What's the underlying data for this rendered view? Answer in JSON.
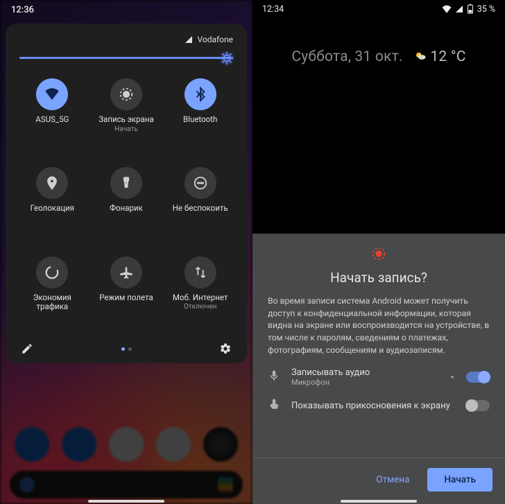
{
  "left": {
    "time": "12:36",
    "carrier": "Vodafone",
    "brightness_percent": 100,
    "tiles": [
      {
        "label": "ASUS_5G",
        "sub": "",
        "on": true,
        "icon": "wifi"
      },
      {
        "label": "Запись экрана",
        "sub": "Начать",
        "on": false,
        "icon": "record"
      },
      {
        "label": "Bluetooth",
        "sub": "",
        "on": true,
        "icon": "bluetooth"
      },
      {
        "label": "Геолокация",
        "sub": "",
        "on": false,
        "icon": "location"
      },
      {
        "label": "Фонарик",
        "sub": "",
        "on": false,
        "icon": "flash"
      },
      {
        "label": "Не беспокоить",
        "sub": "",
        "on": false,
        "icon": "dnd"
      },
      {
        "label": "Экономия\nтрафика",
        "sub": "",
        "on": false,
        "icon": "datasaver"
      },
      {
        "label": "Режим полета",
        "sub": "",
        "on": false,
        "icon": "airplane"
      },
      {
        "label": "Моб. Интернет",
        "sub": "Отключен",
        "on": false,
        "icon": "mobiledata"
      }
    ]
  },
  "right": {
    "time": "12:34",
    "battery_text": "35 %",
    "glance_date": "Суббота, 31 окт.",
    "glance_temp": "12 °C",
    "sheet": {
      "title": "Начать запись?",
      "body": "Во время записи система Android может получить доступ к конфиденциальной информации, которая видна на экране или воспроизводится на устройстве, в том числе к паролям, сведениям о платежах, фотографиям, сообщениям и аудиозаписям.",
      "audio_label": "Записывать аудио",
      "audio_sub": "Микрофон",
      "audio_on": true,
      "touches_label": "Показывать прикосновения к экрану",
      "touches_on": false,
      "cancel": "Отмена",
      "start": "Начать"
    }
  }
}
